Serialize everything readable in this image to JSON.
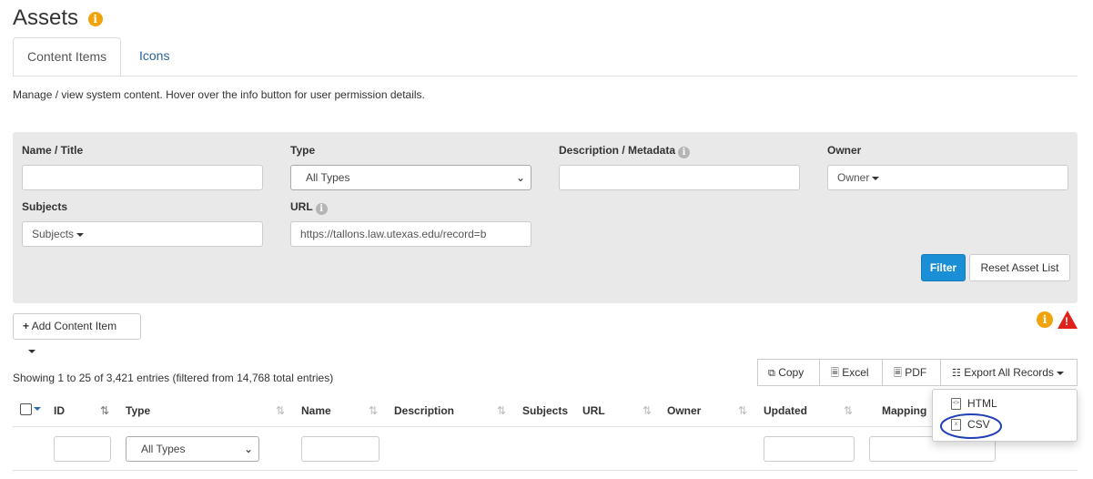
{
  "page": {
    "title": "Assets"
  },
  "tabs": [
    "Content Items",
    "Icons"
  ],
  "description": "Manage / view system content. Hover over the info button for user permission details.",
  "filters": {
    "name_label": "Name / Title",
    "name_value": "",
    "type_label": "Type",
    "type_value": "All Types",
    "meta_label": "Description / Metadata",
    "meta_value": "",
    "owner_label": "Owner",
    "owner_value": "Owner",
    "subjects_label": "Subjects",
    "subjects_value": "Subjects",
    "url_label": "URL",
    "url_value": "https://tallons.law.utexas.edu/record=b",
    "filter_button": "Filter",
    "reset_button": "Reset Asset List"
  },
  "add_content_button": "Add Content Item",
  "showing_text": "Showing 1 to 25 of 3,421 entries (filtered from 14,768 total entries)",
  "export": {
    "copy": "Copy",
    "excel": "Excel",
    "pdf": "PDF",
    "all": "Export All Records",
    "menu": [
      "HTML",
      "CSV"
    ]
  },
  "table": {
    "columns": [
      "ID",
      "Type",
      "Name",
      "Description",
      "Subjects",
      "URL",
      "Owner",
      "Updated",
      "Mapping"
    ],
    "type_filter_value": "All Types"
  },
  "colors": {
    "accent": "#1b8fd6",
    "info": "#f0a30a",
    "warning": "#e0201b",
    "annotation": "#1f3fb5"
  }
}
